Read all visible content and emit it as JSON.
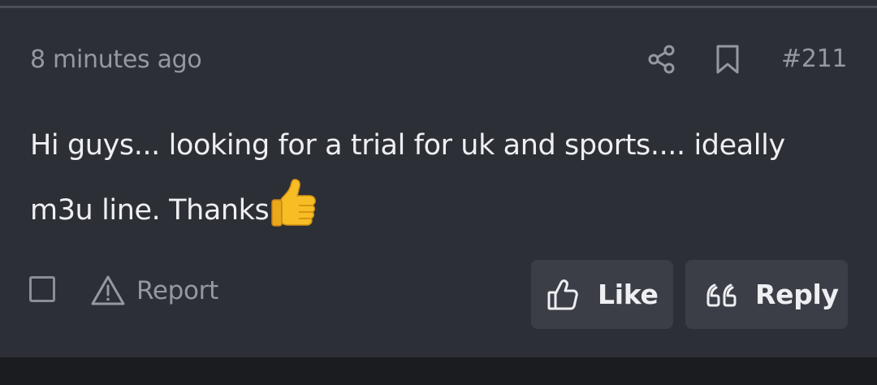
{
  "post": {
    "timestamp": "8 minutes ago",
    "number": "#211",
    "message": "Hi guys... looking for a trial for uk and sports.... ideally m3u line. Thanks",
    "emoji": "thumbs-up"
  },
  "header_icons": [
    "share-icon",
    "bookmark-icon"
  ],
  "footer": {
    "report_label": "Report",
    "report_icon": "warning-triangle-icon",
    "like_label": "Like",
    "like_icon": "thumbs-up-outline-icon",
    "reply_label": "Reply",
    "reply_icon": "quote-icon"
  },
  "colors": {
    "background": "#2d2f36",
    "page_background": "#1b1c20",
    "text": "#eeeff3",
    "muted_text": "#9598a2",
    "button_background": "#3b3e46",
    "divider": "#4a4d56"
  }
}
